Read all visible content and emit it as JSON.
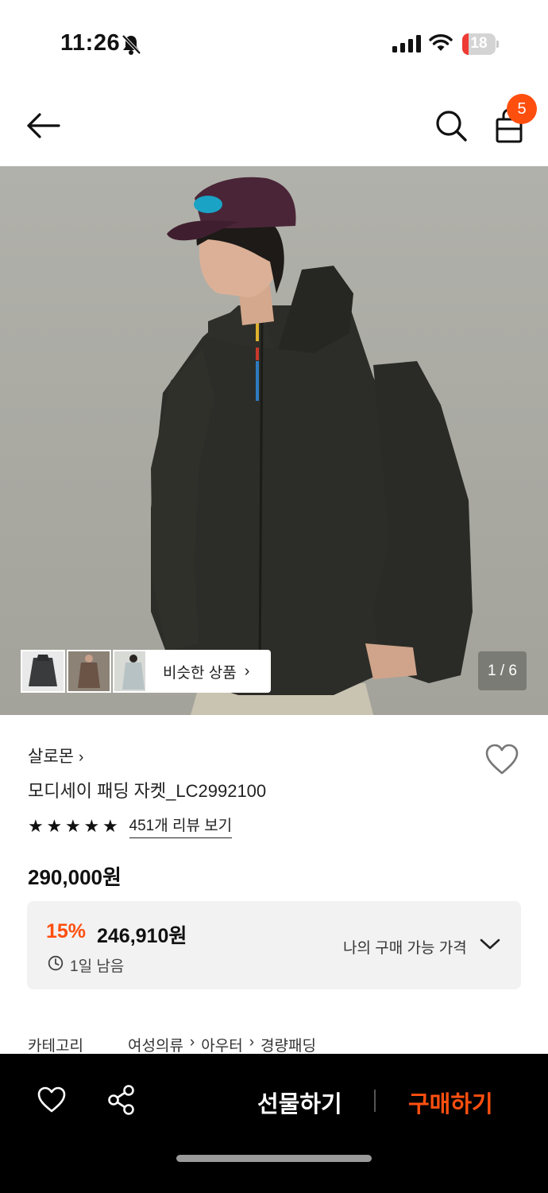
{
  "status_bar": {
    "time": "11:26",
    "battery_level": "18",
    "battery_color": "#ee3b33",
    "icons": [
      "bell-slash-icon",
      "signal-icon",
      "wifi-icon",
      "battery-icon"
    ]
  },
  "nav": {
    "cart_count": "5",
    "accent_color": "#ff4f0f",
    "icons": [
      "back-arrow-icon",
      "search-icon",
      "shopping-bag-icon"
    ]
  },
  "gallery": {
    "similar_label": "비슷한 상품",
    "counter": "1 / 6"
  },
  "product": {
    "brand": "살로몬",
    "name": "모디세이 패딩 자켓_LC2992100",
    "star_count": 5,
    "review_link": "451개 리뷰 보기",
    "price": "290,000원"
  },
  "promo": {
    "discount_rate": "15%",
    "sale_price": "246,910원",
    "remaining": "1일 남음",
    "my_price_label": "나의 구매 가능 가격"
  },
  "category": {
    "label": "카테고리",
    "path": [
      "여성의류",
      "아우터",
      "경량패딩"
    ]
  },
  "bottom_bar": {
    "gift_label": "선물하기",
    "buy_label": "구매하기"
  }
}
